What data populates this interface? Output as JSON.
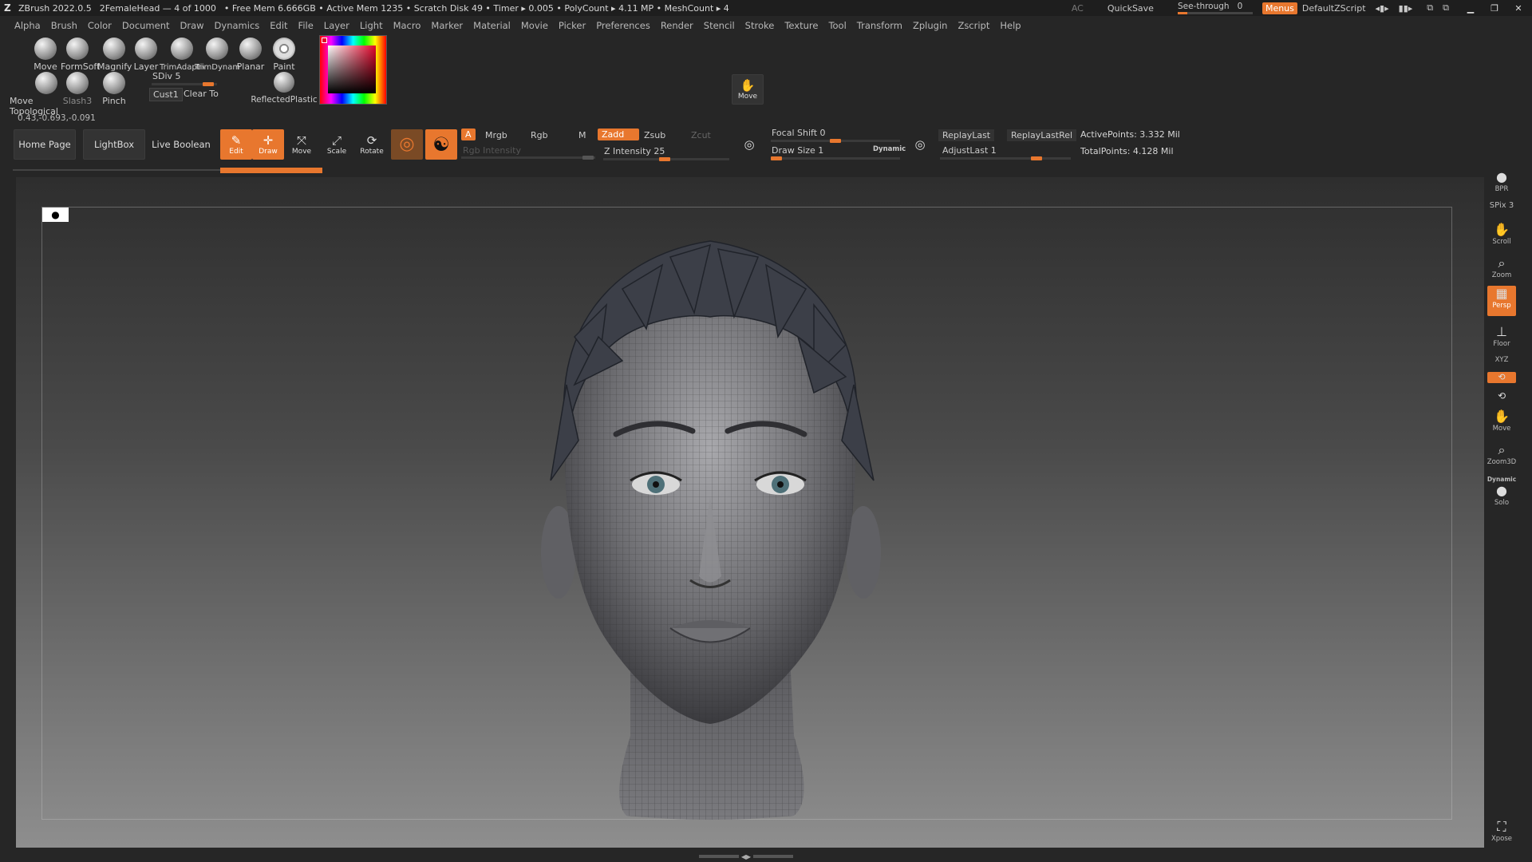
{
  "titlebar": {
    "app": "ZBrush 2022.0.5",
    "doc": "2FemaleHead — 4 of 1000",
    "stats": "• Free Mem 6.666GB • Active Mem 1235 • Scratch Disk 49 • Timer ▸ 0.005 • PolyCount ▸ 4.11 MP • MeshCount ▸ 4",
    "ac": "AC",
    "quicksave": "QuickSave",
    "seethrough_label": "See-through",
    "seethrough_value": "0",
    "menus": "Menus",
    "script": "DefaultZScript"
  },
  "menus": [
    "Alpha",
    "Brush",
    "Color",
    "Document",
    "Draw",
    "Dynamics",
    "Edit",
    "File",
    "Layer",
    "Light",
    "Macro",
    "Marker",
    "Material",
    "Movie",
    "Picker",
    "Preferences",
    "Render",
    "Stencil",
    "Stroke",
    "Texture",
    "Tool",
    "Transform",
    "Zplugin",
    "Zscript",
    "Help"
  ],
  "brushes_row1": [
    "Move",
    "FormSoft",
    "Magnify",
    "Layer",
    "TrimAdaptive",
    "TrimDynamic",
    "Planar",
    "Paint"
  ],
  "brushes_row2": [
    "Move Topological",
    "Slash3",
    "Pinch"
  ],
  "sdiv": {
    "label": "SDiv 5",
    "value": 5
  },
  "cust": "Cust1",
  "clear_to": "Clear To",
  "material": "ReflectedPlastic",
  "move_shelf": "Move",
  "coords": "0.43,-0.693,-0.091",
  "toolbar": {
    "home": "Home Page",
    "lightbox": "LightBox",
    "liveboolean": "Live Boolean",
    "edit": "Edit",
    "draw": "Draw",
    "move": "Move",
    "scale": "Scale",
    "rotate": "Rotate",
    "a": "A",
    "mrgb": "Mrgb",
    "rgb": "Rgb",
    "m": "M",
    "zadd": "Zadd",
    "zsub": "Zsub",
    "zcut": "Zcut",
    "rgb_intensity": "Rgb Intensity",
    "z_intensity": "Z Intensity 25",
    "focal_shift": "Focal Shift 0",
    "draw_size": "Draw Size 1",
    "dynamic": "Dynamic",
    "replaylast": "ReplayLast",
    "replaylastrel": "ReplayLastRel",
    "adjustlast": "AdjustLast 1",
    "activepoints": "ActivePoints: 3.332 Mil",
    "totalpoints": "TotalPoints: 4.128 Mil"
  },
  "rightshelf": {
    "bpr": "BPR",
    "spix": "SPix 3",
    "scroll": "Scroll",
    "zoom": "Zoom",
    "persp": "Persp",
    "floor": "Floor",
    "xyz": "XYZ",
    "move": "Move",
    "zoom3d": "Zoom3D",
    "dynamic": "Dynamic",
    "solo": "Solo",
    "xpose": "Xpose"
  },
  "colors": {
    "accent": "#e8772e",
    "bg": "#262626"
  }
}
